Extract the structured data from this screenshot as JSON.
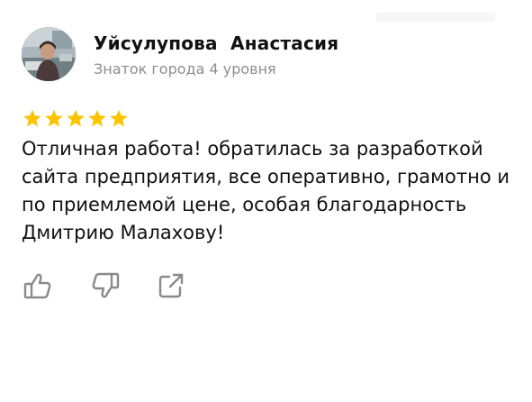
{
  "author": {
    "name": "Уйсулупова  Анастасия",
    "status": "Знаток города 4 уровня"
  },
  "rating": {
    "value": 5,
    "max": 5,
    "star_color": "#fcc400"
  },
  "review": {
    "text": "Отличная работа! обратилась за разработкой сайта предприятия, все оперативно, грамотно и по приемлемой цене, особая благодарность Дмитрию Малахову!"
  },
  "actions": {
    "like_icon": "thumbs-up-icon",
    "dislike_icon": "thumbs-down-icon",
    "share_icon": "share-icon",
    "icon_color": "#8a8a8a"
  }
}
